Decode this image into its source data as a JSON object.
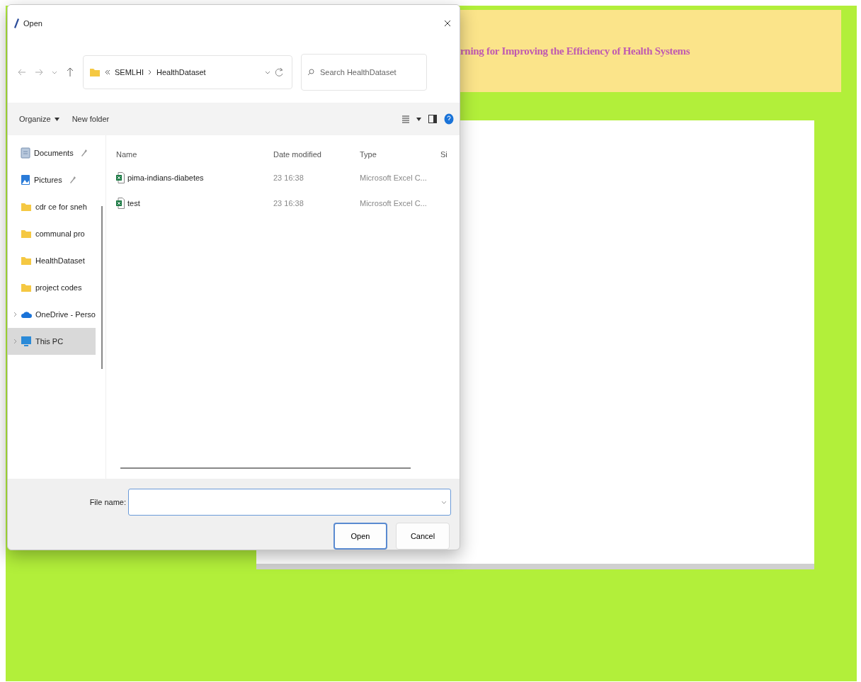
{
  "page": {
    "header": {
      "title": "rning for Improving the Efficiency of Health Systems"
    }
  },
  "dialog": {
    "title": "Open",
    "address": {
      "crumbs": [
        "SEMLHI",
        "HealthDataset"
      ]
    },
    "search": {
      "placeholder": "Search HealthDataset"
    },
    "toolbar": {
      "organize": "Organize",
      "new_folder": "New folder"
    },
    "sidebar": {
      "items": [
        {
          "label": "Documents",
          "kind": "documents",
          "pinned": true,
          "expandable": false,
          "selected": false
        },
        {
          "label": "Pictures",
          "kind": "pictures",
          "pinned": true,
          "expandable": false,
          "selected": false
        },
        {
          "label": "cdr ce for sneh",
          "kind": "folder",
          "pinned": false,
          "expandable": false,
          "selected": false
        },
        {
          "label": "communal pro",
          "kind": "folder",
          "pinned": false,
          "expandable": false,
          "selected": false
        },
        {
          "label": "HealthDataset",
          "kind": "folder",
          "pinned": false,
          "expandable": false,
          "selected": false
        },
        {
          "label": "project codes",
          "kind": "folder",
          "pinned": false,
          "expandable": false,
          "selected": false
        },
        {
          "label": "OneDrive - Perso",
          "kind": "cloud",
          "pinned": false,
          "expandable": true,
          "selected": false
        },
        {
          "label": "This PC",
          "kind": "pc",
          "pinned": false,
          "expandable": true,
          "selected": true
        }
      ]
    },
    "files": {
      "columns": [
        "Name",
        "Date modified",
        "Type",
        "Si"
      ],
      "rows": [
        {
          "name": "pima-indians-diabetes",
          "date": "23 16:38",
          "type": "Microsoft Excel C..."
        },
        {
          "name": "test",
          "date": "23 16:38",
          "type": "Microsoft Excel C..."
        }
      ]
    },
    "file_name": {
      "label": "File name:"
    },
    "buttons": [
      {
        "label": "Open",
        "primary": true
      },
      {
        "label": "Cancel",
        "primary": false
      }
    ]
  }
}
